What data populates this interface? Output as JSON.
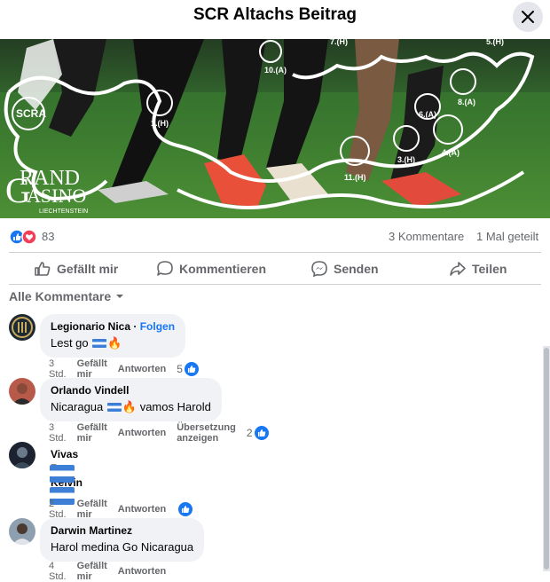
{
  "header": {
    "title": "SCR Altachs Beitrag",
    "close_icon": "close-icon"
  },
  "banner": {
    "club_abbr": "SCRA",
    "sponsor_line1": "RAND",
    "sponsor_line2": "ASINO",
    "sponsor_sub": "LIECHTENSTEIN",
    "match_labels": [
      "10.(A)",
      "7.(H)",
      "5.(H)",
      "1.(H)",
      "8.(A)",
      "6.(A)",
      "4.(A)",
      "3.(H)",
      "11.(H)"
    ]
  },
  "reactions": {
    "count": "83",
    "comments": "3 Kommentare",
    "shares": "1 Mal geteilt",
    "icons": [
      "like-icon",
      "love-icon"
    ]
  },
  "actions": {
    "like": "Gefällt mir",
    "comment": "Kommentieren",
    "send": "Senden",
    "share": "Teilen"
  },
  "sort": {
    "label": "Alle Kommentare"
  },
  "comments": [
    {
      "author": "Legionario Nica",
      "follow": "Folgen",
      "text": "Lest go",
      "time": "3 Std.",
      "like": "Gefällt mir",
      "reply": "Antworten",
      "likes": "5"
    },
    {
      "author": "Orlando Vindell",
      "text": "Nicaragua",
      "text2": "vamos Harold",
      "time": "3 Std.",
      "like": "Gefällt mir",
      "reply": "Antworten",
      "translate": "Übersetzung anzeigen",
      "likes": "2"
    },
    {
      "author": "Vivas R Kelvin",
      "text": "",
      "time": "2 Std.",
      "like": "Gefällt mir",
      "reply": "Antworten",
      "likes": ""
    },
    {
      "author": "Darwin Martinez",
      "text": "Harol medina Go Nicaragua",
      "time": "4 Std.",
      "like": "Gefällt mir",
      "reply": "Antworten"
    }
  ],
  "colors": {
    "accent": "#1877f2",
    "muted": "#65676b",
    "bubble": "#f0f2f5"
  }
}
